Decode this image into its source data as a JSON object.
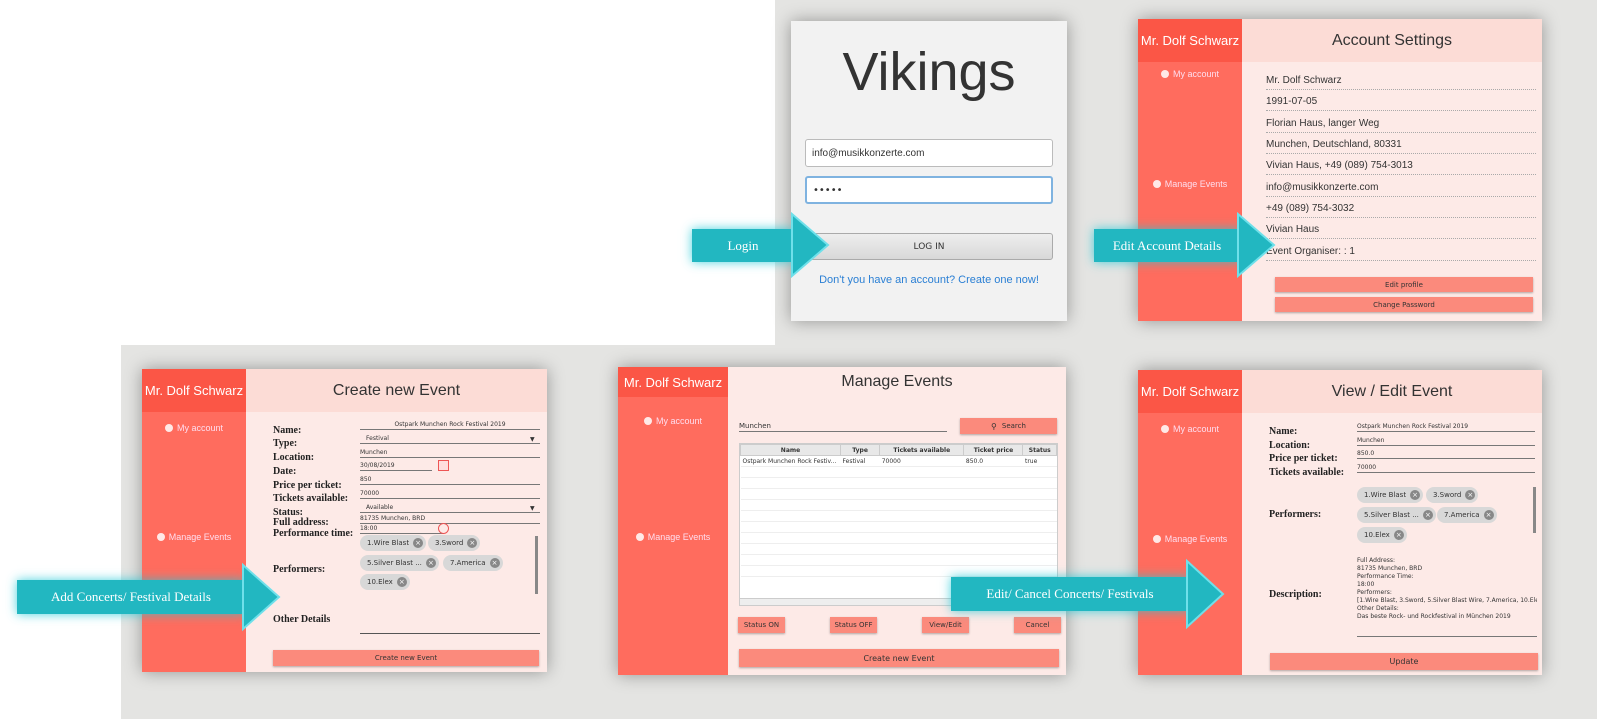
{
  "login": {
    "title": "Vikings",
    "email": "info@musikkonzerte.com",
    "password": "•••••",
    "button": "LOG IN",
    "create_link": "Don't you have an account? Create one now!"
  },
  "sidebar": {
    "user": "Mr. Dolf Schwarz",
    "my_account": "My account",
    "manage_events": "Manage Events"
  },
  "account": {
    "title": "Account Settings",
    "rows": [
      "Mr. Dolf Schwarz",
      "1991-07-05",
      "Florian Haus, langer Weg",
      "Munchen, Deutschland, 80331",
      "Vivian Haus, +49 (089) 754-3013",
      "info@musikkonzerte.com",
      "+49 (089) 754-3032",
      "Vivian Haus",
      "Event Organiser: : 1"
    ],
    "edit_profile": "Edit profile",
    "change_password": "Change Password"
  },
  "create": {
    "title": "Create new Event",
    "labels": {
      "name": "Name:",
      "type": "Type:",
      "location": "Location:",
      "date": "Date:",
      "price": "Price per ticket:",
      "tickets": "Tickets available:",
      "status": "Status:",
      "address": "Full address:",
      "perf_time": "Performance time:",
      "performers": "Performers:",
      "other": "Other Details"
    },
    "values": {
      "name": "Ostpark Munchen Rock Festival 2019",
      "type": "Festival",
      "location": "Munchen",
      "date": "30/08/2019",
      "price": "850",
      "tickets": "70000",
      "status": "Available",
      "address": "81735 Munchen, BRD",
      "perf_time": "18:00"
    },
    "button": "Create new Event"
  },
  "performers": [
    "1.Wire Blast",
    "3.Sword",
    "5.Silver Blast ...",
    "7.America",
    "10.Elex"
  ],
  "manage": {
    "title": "Manage Events",
    "search_value": "Munchen",
    "search_button": "Search",
    "columns": [
      "Name",
      "Type",
      "Tickets available",
      "Ticket price",
      "Status"
    ],
    "rows": [
      [
        "Ostpark Munchen Rock Festiv...",
        "Festival",
        "70000",
        "850.0",
        "true"
      ]
    ],
    "buttons": [
      "Status ON",
      "Status OFF",
      "View/Edit",
      "Cancel"
    ],
    "create_button": "Create new Event"
  },
  "view": {
    "title": "View / Edit Event",
    "labels": {
      "name": "Name:",
      "location": "Location:",
      "price": "Price per ticket:",
      "tickets": "Tickets available:",
      "performers": "Performers:",
      "description": "Description:"
    },
    "values": {
      "name": "Ostpark Munchen Rock Festival 2019",
      "location": "Munchen",
      "price": "850.0",
      "tickets": "70000"
    },
    "description": [
      "Full Address:",
      "81735 Munchen, BRD",
      "Performance Time:",
      "18:00",
      "Performers:",
      "[1.Wire Blast, 3.Sword, 5.Silver Blast Wire, 7.America, 10.Elex]",
      "Other Details:",
      "Das beste Rock- und Rockfestival in München 2019"
    ],
    "button": "Update"
  },
  "arrows": {
    "login": "Login",
    "edit_account": "Edit Account Details",
    "add": "Add Concerts/ Festival Details",
    "edit_cancel": "Edit/ Cancel Concerts/ Festivals"
  },
  "colors": {
    "sidebar": "#ff6c5e",
    "sidebar_head": "#fb5646",
    "panel": "#fdeae7",
    "button": "#fb8a7c",
    "arrow": "#22b7c1"
  }
}
